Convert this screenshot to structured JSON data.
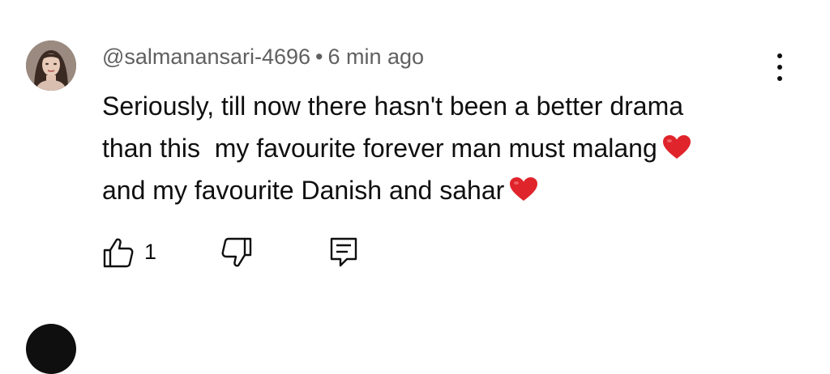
{
  "comment": {
    "author": "@salmanansari-4696",
    "separator": "•",
    "time": "6 min ago",
    "lines": [
      "Seriously, till now there hasn't been a better drama",
      "than this  my favourite forever man must malang",
      "and my favourite Danish and sahar"
    ],
    "like_count": "1"
  },
  "icons": {
    "more": "more-vertical-icon",
    "heart": "red-heart-emoji",
    "like": "thumbs-up-icon",
    "dislike": "thumbs-down-icon",
    "reply": "reply-comment-icon"
  },
  "colors": {
    "meta_text": "#606060",
    "body_text": "#0f0f0f",
    "heart": "#e0242b"
  }
}
